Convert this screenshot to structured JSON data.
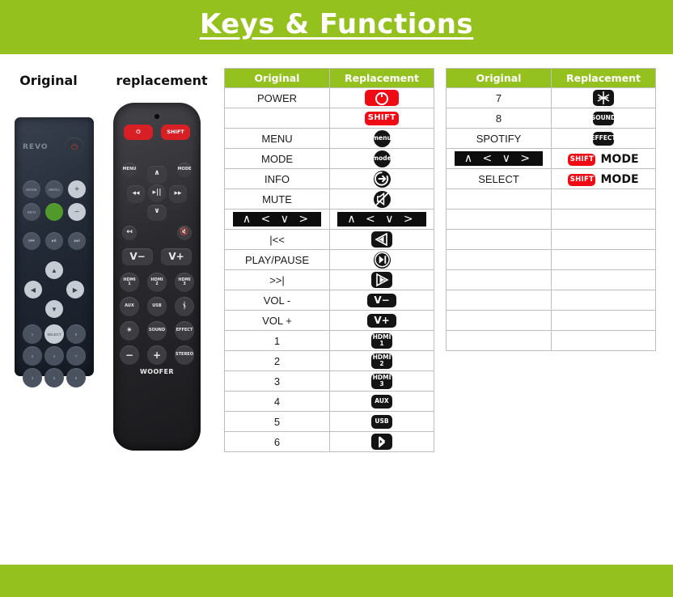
{
  "page": {
    "title": "Keys & Functions",
    "accent_green": "#95c11f",
    "accent_red": "#ef0a14",
    "chip_black": "#141414"
  },
  "remotes": {
    "original_label": "Original",
    "replacement_label": "replacement",
    "original": {
      "brand": "REVO",
      "buttons": [
        "MODE",
        "MENU",
        "+",
        "INFO",
        "●",
        "−",
        "|◀",
        "▶||",
        "▶|",
        "1",
        "SELECT",
        "6",
        "2",
        "4",
        "7",
        "3",
        "5",
        "8"
      ]
    },
    "replacement": {
      "power_label": "⏻",
      "shift_label": "SHIFT",
      "menu_label": "MENU",
      "mode_label": "MODE",
      "vol_down_label": "V−",
      "vol_up_label": "V+",
      "source_buttons": [
        "HDMI 1",
        "HDMI 2",
        "HDMI 3",
        "AUX",
        "USB",
        "BT"
      ],
      "feature_buttons": [
        "LIGHT",
        "SOUND",
        "EFFECT"
      ],
      "woofer_label": "WOOFER",
      "woofer_buttons": [
        "−",
        "+",
        "STEREO"
      ]
    }
  },
  "table_left": {
    "headers": [
      "Original",
      "Replacement"
    ],
    "rows": [
      {
        "original": "POWER",
        "replacement_kind": "chip-power",
        "replacement": ""
      },
      {
        "original": "",
        "replacement_kind": "chip-shift",
        "replacement": "SHIFT"
      },
      {
        "original": "MENU",
        "replacement_kind": "chip-circ",
        "replacement": "menu"
      },
      {
        "original": "MODE",
        "replacement_kind": "chip-circ",
        "replacement": "mode"
      },
      {
        "original": "INFO",
        "replacement_kind": "chip-info",
        "replacement": ""
      },
      {
        "original": "MUTE",
        "replacement_kind": "chip-mute",
        "replacement": ""
      },
      {
        "original": "∧ < ∨ >",
        "original_kind": "arrowbar",
        "replacement_kind": "arrowbar",
        "replacement": "∧ < ∨ >"
      },
      {
        "original": "|<<",
        "replacement_kind": "chip-rew",
        "replacement": ""
      },
      {
        "original": "PLAY/PAUSE",
        "replacement_kind": "chip-play",
        "replacement": ""
      },
      {
        "original": ">>|",
        "replacement_kind": "chip-ff",
        "replacement": ""
      },
      {
        "original": "VOL -",
        "replacement_kind": "chip-vol",
        "replacement": "V−"
      },
      {
        "original": "VOL +",
        "replacement_kind": "chip-vol",
        "replacement": "V+"
      },
      {
        "original": "1",
        "replacement_kind": "chip-hdmi",
        "replacement": "HDMI",
        "replacement2": "1"
      },
      {
        "original": "2",
        "replacement_kind": "chip-hdmi",
        "replacement": "HDMI",
        "replacement2": "2"
      },
      {
        "original": "3",
        "replacement_kind": "chip-hdmi",
        "replacement": "HDMI",
        "replacement2": "3"
      },
      {
        "original": "4",
        "replacement_kind": "chip-txt",
        "replacement": "AUX"
      },
      {
        "original": "5",
        "replacement_kind": "chip-txt",
        "replacement": "USB"
      },
      {
        "original": "6",
        "replacement_kind": "chip-bt",
        "replacement": ""
      }
    ]
  },
  "table_right": {
    "headers": [
      "Original",
      "Replacement"
    ],
    "rows": [
      {
        "original": "7",
        "replacement_kind": "chip-light",
        "replacement": ""
      },
      {
        "original": "8",
        "replacement_kind": "chip-txt",
        "replacement": "SOUND"
      },
      {
        "original": "SPOTIFY",
        "replacement_kind": "chip-txt",
        "replacement": "EFFECT"
      },
      {
        "original": "∧ < ∨ >",
        "original_kind": "arrowbar",
        "replacement_kind": "combo",
        "replacement": "SHIFT",
        "replacement2": "MODE"
      },
      {
        "original": "SELECT",
        "replacement_kind": "combo",
        "replacement": "SHIFT",
        "replacement2": "MODE"
      },
      {
        "original": "",
        "replacement_kind": "empty",
        "replacement": ""
      },
      {
        "original": "",
        "replacement_kind": "empty",
        "replacement": ""
      },
      {
        "original": "",
        "replacement_kind": "empty",
        "replacement": ""
      },
      {
        "original": "",
        "replacement_kind": "empty",
        "replacement": ""
      },
      {
        "original": "",
        "replacement_kind": "empty",
        "replacement": ""
      },
      {
        "original": "",
        "replacement_kind": "empty",
        "replacement": ""
      },
      {
        "original": "",
        "replacement_kind": "empty",
        "replacement": ""
      },
      {
        "original": "",
        "replacement_kind": "empty",
        "replacement": ""
      }
    ]
  }
}
